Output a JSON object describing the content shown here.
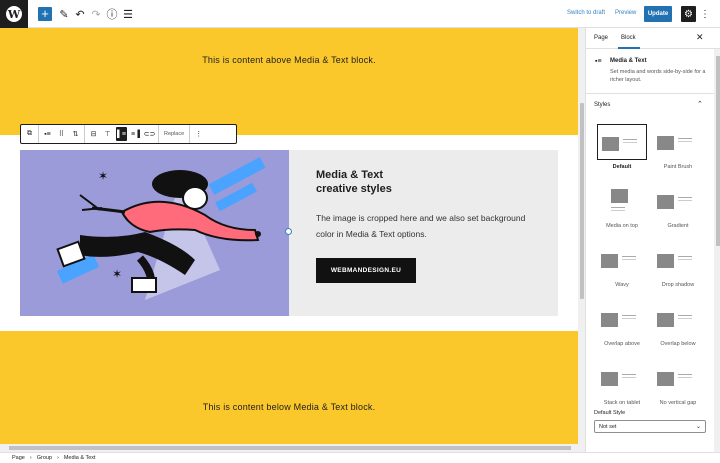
{
  "topbar": {
    "add_icon": "plus-icon",
    "tools_icon": "pencil-icon",
    "undo_icon": "undo-icon",
    "redo_icon": "redo-icon",
    "info_icon": "info-icon",
    "outline_icon": "list-view-icon",
    "switch_to_draft": "Switch to draft",
    "preview": "Preview",
    "update": "Update",
    "settings_icon": "gear-icon",
    "more_icon": "more-vertical-icon"
  },
  "editor": {
    "above_text": "This is content above Media & Text block.",
    "below_text": "This is content below Media & Text block.",
    "toolbar": {
      "replace": "Replace"
    },
    "media_text": {
      "heading_line1": "Media & Text",
      "heading_line2": "creative styles",
      "paragraph": "The image is cropped here and we also set background color in Media & Text options.",
      "button": "WEBMANDESIGN.EU",
      "media_bg": "#9b9bd9",
      "content_bg": "#ececec"
    },
    "group_bg": "#fbc82b"
  },
  "sidebar": {
    "tab_page": "Page",
    "tab_block": "Block",
    "block_title": "Media & Text",
    "block_desc": "Set media and words side-by-side for a richer layout.",
    "styles_heading": "Styles",
    "styles": [
      {
        "label": "Default",
        "selected": true
      },
      {
        "label": "Paint Brush",
        "selected": false
      },
      {
        "label": "Media on top",
        "selected": false
      },
      {
        "label": "Gradient",
        "selected": false
      },
      {
        "label": "Wavy",
        "selected": false
      },
      {
        "label": "Drop shadow",
        "selected": false
      },
      {
        "label": "Overlap above",
        "selected": false
      },
      {
        "label": "Overlap below",
        "selected": false
      },
      {
        "label": "Stack on tablet",
        "selected": false
      },
      {
        "label": "No vertical gap",
        "selected": false
      }
    ],
    "default_style_label": "Default Style",
    "default_style_value": "Not set"
  },
  "footer": {
    "crumbs": [
      "Page",
      "Group",
      "Media & Text"
    ]
  },
  "colors": {
    "accent": "#2271b1",
    "dark": "#1e1e1e",
    "yellow": "#fbc82b"
  }
}
